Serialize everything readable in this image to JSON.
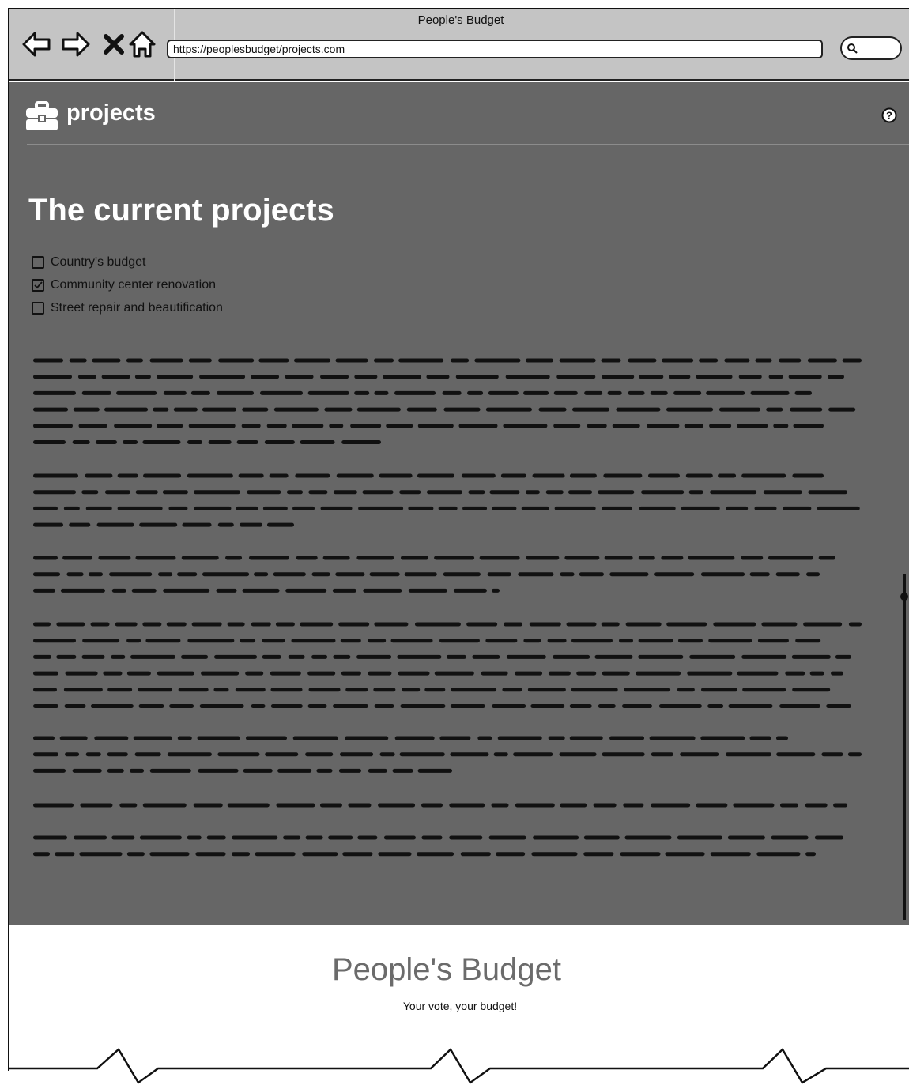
{
  "window": {
    "title": "People's Budget"
  },
  "browser": {
    "url": "https://peoplesbudget/projects.com",
    "nav_icons": [
      "back-arrow-icon",
      "forward-arrow-icon",
      "close-x-icon",
      "home-icon"
    ],
    "search_icon": "search-icon"
  },
  "header": {
    "brand_icon": "briefcase-icon",
    "brand_label": "projects",
    "help_icon": "help-icon"
  },
  "main": {
    "title": "The current projects",
    "checklist": [
      {
        "label": "Country's budget",
        "checked": false
      },
      {
        "label": "Community center renovation",
        "checked": true
      },
      {
        "label": "Street repair and beautification",
        "checked": false
      }
    ]
  },
  "footer": {
    "title": "People's Budget",
    "tagline": "Your vote, your budget!"
  },
  "colors": {
    "chrome": "#c4c4c4",
    "panel": "#666666",
    "footer_title": "#6b6b6b"
  }
}
